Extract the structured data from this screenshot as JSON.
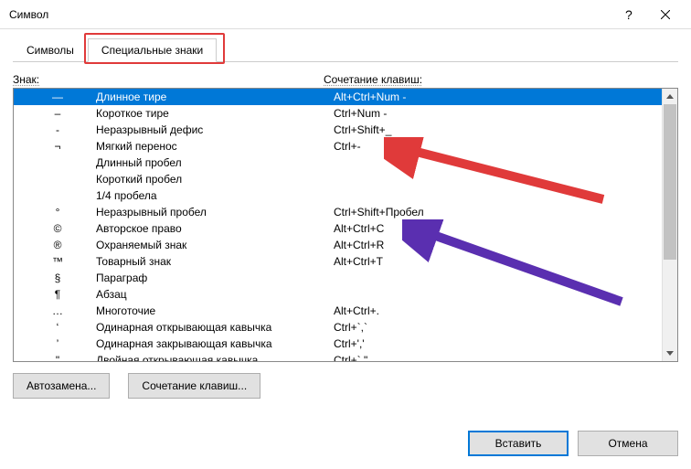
{
  "window": {
    "title": "Символ"
  },
  "tabs": {
    "symbols": "Символы",
    "special": "Специальные знаки",
    "active": "special"
  },
  "columns": {
    "symbol": "Знак:",
    "shortcut": "Сочетание клавиш:"
  },
  "list": [
    {
      "sym": "—",
      "name": "Длинное тире",
      "shortcut": "Alt+Ctrl+Num -",
      "selected": true
    },
    {
      "sym": "–",
      "name": "Короткое тире",
      "shortcut": "Ctrl+Num -"
    },
    {
      "sym": "-",
      "name": "Неразрывный дефис",
      "shortcut": "Ctrl+Shift+_"
    },
    {
      "sym": "¬",
      "name": "Мягкий перенос",
      "shortcut": "Ctrl+-"
    },
    {
      "sym": "",
      "name": "Длинный пробел",
      "shortcut": ""
    },
    {
      "sym": "",
      "name": "Короткий пробел",
      "shortcut": ""
    },
    {
      "sym": "",
      "name": "1/4 пробела",
      "shortcut": ""
    },
    {
      "sym": "°",
      "name": "Неразрывный пробел",
      "shortcut": "Ctrl+Shift+Пробел"
    },
    {
      "sym": "©",
      "name": "Авторское право",
      "shortcut": "Alt+Ctrl+C"
    },
    {
      "sym": "®",
      "name": "Охраняемый знак",
      "shortcut": "Alt+Ctrl+R"
    },
    {
      "sym": "™",
      "name": "Товарный знак",
      "shortcut": "Alt+Ctrl+T"
    },
    {
      "sym": "§",
      "name": "Параграф",
      "shortcut": ""
    },
    {
      "sym": "¶",
      "name": "Абзац",
      "shortcut": ""
    },
    {
      "sym": "…",
      "name": "Многоточие",
      "shortcut": "Alt+Ctrl+."
    },
    {
      "sym": "‘",
      "name": "Одинарная открывающая кавычка",
      "shortcut": "Ctrl+`,`"
    },
    {
      "sym": "’",
      "name": "Одинарная закрывающая кавычка",
      "shortcut": "Ctrl+','"
    },
    {
      "sym": "\"",
      "name": "Двойная открывающая кавычка",
      "shortcut": "Ctrl+`,\""
    }
  ],
  "buttons": {
    "autocorrect": "Автозамена...",
    "shortcut_assign": "Сочетание клавиш...",
    "insert": "Вставить",
    "cancel": "Отмена"
  }
}
